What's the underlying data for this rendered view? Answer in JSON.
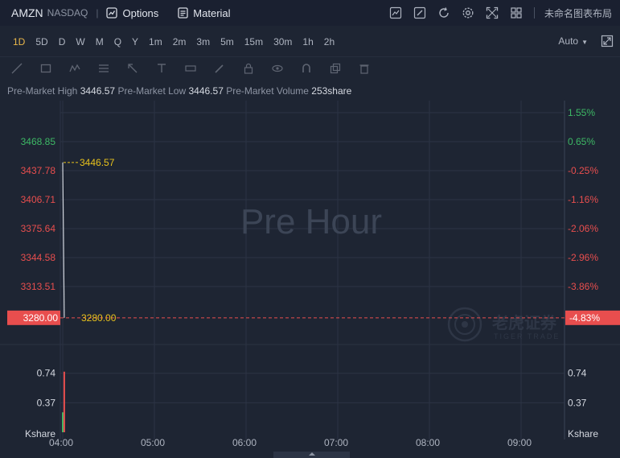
{
  "header": {
    "symbol": "AMZN",
    "exchange": "NASDAQ",
    "options_label": "Options",
    "material_label": "Material",
    "layout_name": "未命名图表布局"
  },
  "periods": {
    "items": [
      "1D",
      "5D",
      "D",
      "W",
      "M",
      "Q",
      "Y",
      "1m",
      "2m",
      "3m",
      "5m",
      "15m",
      "30m",
      "1h",
      "2h"
    ],
    "active": "1D",
    "scale_mode": "Auto"
  },
  "info": {
    "high_label": "Pre-Market High",
    "high_value": "3446.57",
    "low_label": "Pre-Market Low",
    "low_value": "3446.57",
    "volume_label": "Pre-Market Volume",
    "volume_value": "253share"
  },
  "chart_data": {
    "type": "line",
    "watermark": "Pre Hour",
    "brand": "老虎证券",
    "brand_sub": "TIGER TRADE",
    "x_ticks": [
      "04:00",
      "05:00",
      "06:00",
      "07:00",
      "08:00",
      "09:00"
    ],
    "y_ticks": [
      "3468.85",
      "3437.78",
      "3406.71",
      "3375.64",
      "3344.58",
      "3313.51"
    ],
    "y_tick_values": [
      3468.85,
      3437.78,
      3406.71,
      3375.64,
      3344.58,
      3313.51
    ],
    "y_pct_ticks": [
      "1.55%",
      "0.65%",
      "-0.25%",
      "-1.16%",
      "-2.06%",
      "-2.96%",
      "-3.86%"
    ],
    "base_close": 3446.57,
    "current_price": "3280.00",
    "current_pct": "-4.83%",
    "high_marker": "3446.57",
    "series": [
      {
        "x": [
          "04:00",
          "04:01"
        ],
        "values": [
          3446.57,
          3280.0
        ]
      }
    ],
    "volume": {
      "unit": "Kshare",
      "ticks": [
        "0.74",
        "0.37"
      ],
      "tick_values": [
        0.74,
        0.37
      ],
      "bars": [
        {
          "x": "04:00",
          "value": 0.25,
          "dir": "up"
        },
        {
          "x": "04:01",
          "value": 0.76,
          "dir": "down"
        }
      ]
    },
    "colors": {
      "up": "#3db865",
      "down": "#e84e4e",
      "accent": "#e8c21c",
      "grid": "#2c3445",
      "line": "#d0d4dc"
    }
  }
}
